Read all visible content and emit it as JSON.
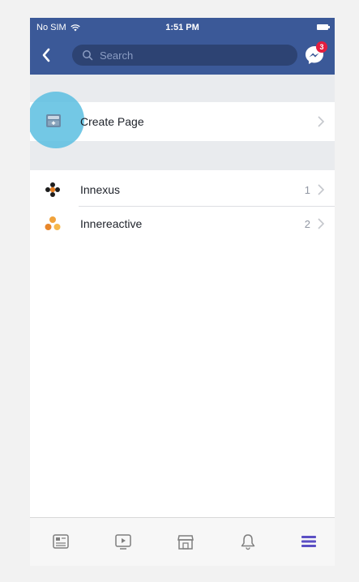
{
  "status_bar": {
    "carrier": "No SIM",
    "time": "1:51 PM"
  },
  "header": {
    "search_placeholder": "Search",
    "messenger_badge": "3",
    "color": "#3b5998"
  },
  "create_page": {
    "label": "Create Page"
  },
  "pages": [
    {
      "name": "Innexus",
      "count": "1",
      "icon": "innexus-logo-icon"
    },
    {
      "name": "Innereactive",
      "count": "2",
      "icon": "innereactive-logo-icon"
    }
  ],
  "tabbar": {
    "items": [
      {
        "icon": "news-feed-icon"
      },
      {
        "icon": "watch-video-icon"
      },
      {
        "icon": "marketplace-icon"
      },
      {
        "icon": "notifications-bell-icon"
      },
      {
        "icon": "menu-hamburger-icon",
        "active": true
      }
    ],
    "active_color": "#5b4fc4"
  }
}
